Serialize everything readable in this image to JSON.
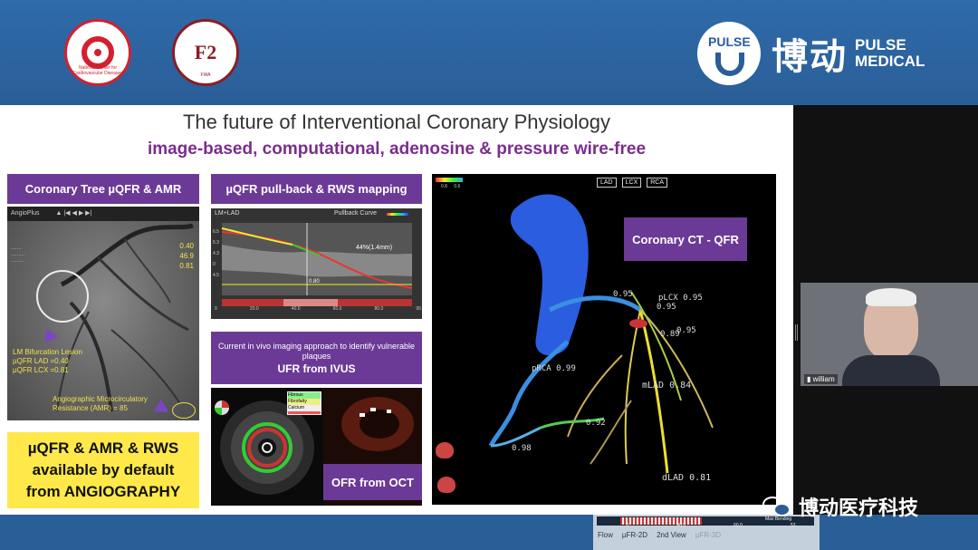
{
  "banner": {
    "brand_pulse_word": "PULSE",
    "brand_cn": "博动",
    "brand_en_line1": "PULSE",
    "brand_en_line2": "MEDICAL",
    "logo_ncc_text": "National Center for Cardiovascular Diseases",
    "logo_fw_letters": "F2",
    "logo_fw_text": "FWA"
  },
  "slide": {
    "title": "The future of Interventional Coronary Physiology",
    "subtitle": "image-based, computational, adenosine & pressure wire-free",
    "label_tree": "Coronary Tree µQFR & AMR",
    "label_pullback": "µQFR pull-back & RWS mapping",
    "label_ivus": "Current in vivo imaging approach to identify vulnerable plaques",
    "label_ivus_bold": "UFR from IVUS",
    "label_oct": "OFR from OCT",
    "label_ct": "Coronary CT - QFR",
    "yellow_line1": "µQFR & AMR & RWS",
    "yellow_line2": "available by default",
    "yellow_line3": "from ANGIOGRAPHY",
    "angio": {
      "app": "AngioPlus",
      "lesion": "LM Bifurcation Lesion",
      "qfr_lad": "µQFR LAD =0.40",
      "qfr_lcx": "µQFR LCX =0.81",
      "amr": "Angiographic Microcirculatory",
      "amr2": "Resistance (AMR) = 85",
      "ann1": "0.40",
      "ann2": "46.9",
      "ann3": "0.81"
    },
    "pullback": {
      "header": "LM+LAD",
      "legend": "Pullback Curve",
      "pct": "44%(1.4mm)",
      "v1": "0.80",
      "x_ticks": [
        "0",
        "20.0",
        "40.0",
        "60.0",
        "80.0",
        "95"
      ],
      "y_ticks": [
        "6.5",
        "5.3",
        "4.3",
        "0",
        "4.5"
      ]
    },
    "ivus_legend": [
      "Fibrous",
      "Fibrofatty",
      "Calcium"
    ],
    "ct": {
      "tabs": [
        "LAD",
        "LCX",
        "RCA"
      ],
      "scale": [
        "0.8",
        "0.6"
      ],
      "l_lcx": "pLCX 0.95",
      "l_95": "0.95",
      "l_89": "0.89",
      "l_95b": "0.95",
      "l_prca": "pRCA 0.99",
      "l_mlad": "mLAD 0.84",
      "l_92": "0.92",
      "l_98": "0.98",
      "l_dlad": "dLAD 0.81",
      "l_top": "0.95"
    }
  },
  "webcam": {
    "name": "william"
  },
  "bottom": {
    "tabs": [
      "Flow",
      "µFR-2D",
      "2nd View",
      "µFR-3D"
    ],
    "strip_ticks": [
      "0",
      "40.0",
      "60.0",
      "53"
    ],
    "strip_label": "Max Bending"
  },
  "watermark": {
    "text": "博动医疗科技"
  }
}
